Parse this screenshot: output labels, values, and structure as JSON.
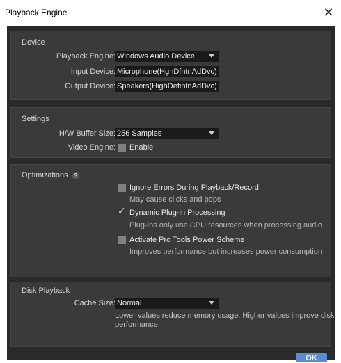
{
  "window": {
    "title": "Playback Engine",
    "close_glyph": "✕"
  },
  "device": {
    "section_title": "Device",
    "playback_engine_label": "Playback Engine:",
    "playback_engine_value": "Windows Audio Device",
    "input_device_label": "Input Device:",
    "input_device_value": "Microphone(HghDfntnAdDvc)",
    "output_device_label": "Output Device:",
    "output_device_value": "Speakers(HighDefintnAdDvc)"
  },
  "settings": {
    "section_title": "Settings",
    "buffer_label": "H/W Buffer Size:",
    "buffer_value": "256 Samples",
    "video_label": "Video Engine:",
    "video_enable_label": "Enable",
    "video_enabled": false
  },
  "optimizations": {
    "section_title": "Optimizations",
    "help_glyph": "?",
    "options": [
      {
        "label": "Ignore Errors During Playback/Record",
        "description": "May cause clicks and pops",
        "checked": false
      },
      {
        "label": "Dynamic Plug-in Processing",
        "description": "Plug-ins only use CPU resources when processing audio",
        "checked": true,
        "check_glyph": "✓"
      },
      {
        "label": "Activate Pro Tools Power Scheme",
        "description": "Improves performance but increases power consumption",
        "checked": false
      }
    ]
  },
  "disk_playback": {
    "section_title": "Disk Playback",
    "cache_label": "Cache Size:",
    "cache_value": "Normal",
    "description_line1": "Lower values reduce memory usage. Higher values improve disk",
    "description_line2": "performance."
  },
  "footer": {
    "ok_label": "OK"
  },
  "colors": {
    "background": "#2a2a2a",
    "panel": "#3a3a3a",
    "field": "#1a1a1a",
    "accent": "#5b8bd0"
  }
}
